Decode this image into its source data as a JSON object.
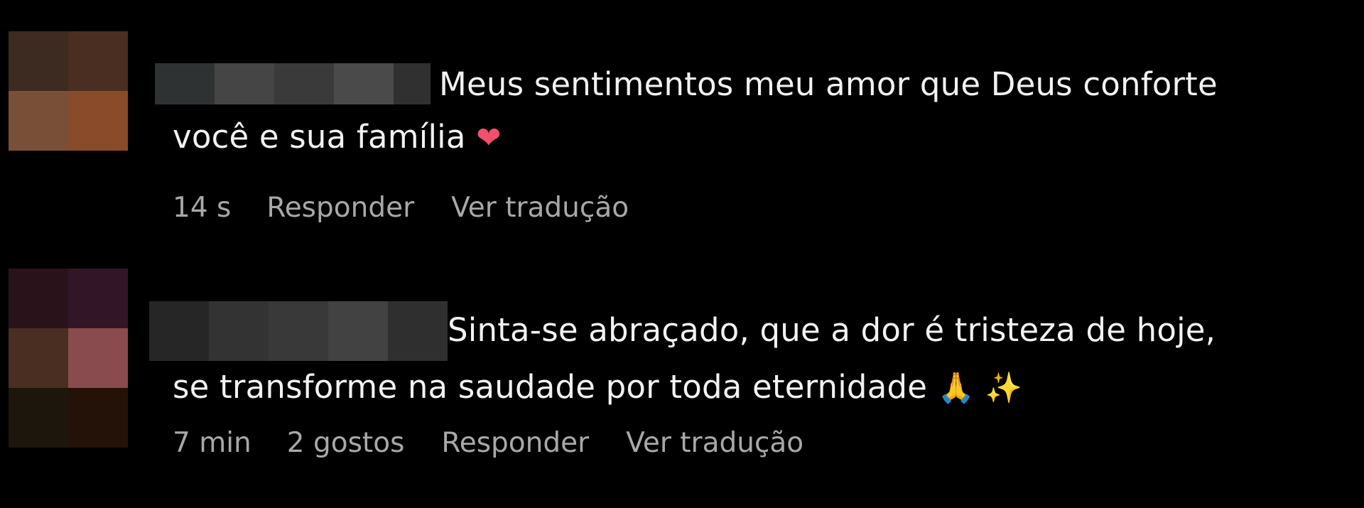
{
  "comments": [
    {
      "text_line1": "Meus sentimentos meu amor que Deus conforte",
      "text_line2": "você e sua família",
      "emoji": [
        "heart-emoji"
      ],
      "time": "14 s",
      "likes": "",
      "reply_label": "Responder",
      "translate_label": "Ver tradução",
      "avatar_colors": [
        "#3d2a21",
        "#4a2e21",
        "#7a4f37",
        "#8a4b2a"
      ],
      "username_colors": [
        "#2f3233",
        "#454545",
        "#3a3a3a",
        "#4a4a4a",
        "#303030"
      ]
    },
    {
      "text_line1": "Sinta-se abraçado, que a dor é tristeza de hoje,",
      "text_line2": "se transforme na saudade por toda eternidade",
      "emoji": [
        "folded-hands-emoji",
        "sparkles-emoji"
      ],
      "time": "7 min",
      "likes": "2 gostos",
      "reply_label": "Responder",
      "translate_label": "Ver tradução",
      "avatar_colors": [
        "#2a121b",
        "#321628",
        "#4a2e22",
        "#8a4b4e",
        "#1d160d",
        "#241209"
      ],
      "username_colors": [
        "#262626",
        "#333333",
        "#393939",
        "#424242",
        "#2f2f2f"
      ]
    }
  ],
  "emoji_glyphs": {
    "heart": "❤",
    "pray": "🙏",
    "sparkles": "✨"
  }
}
